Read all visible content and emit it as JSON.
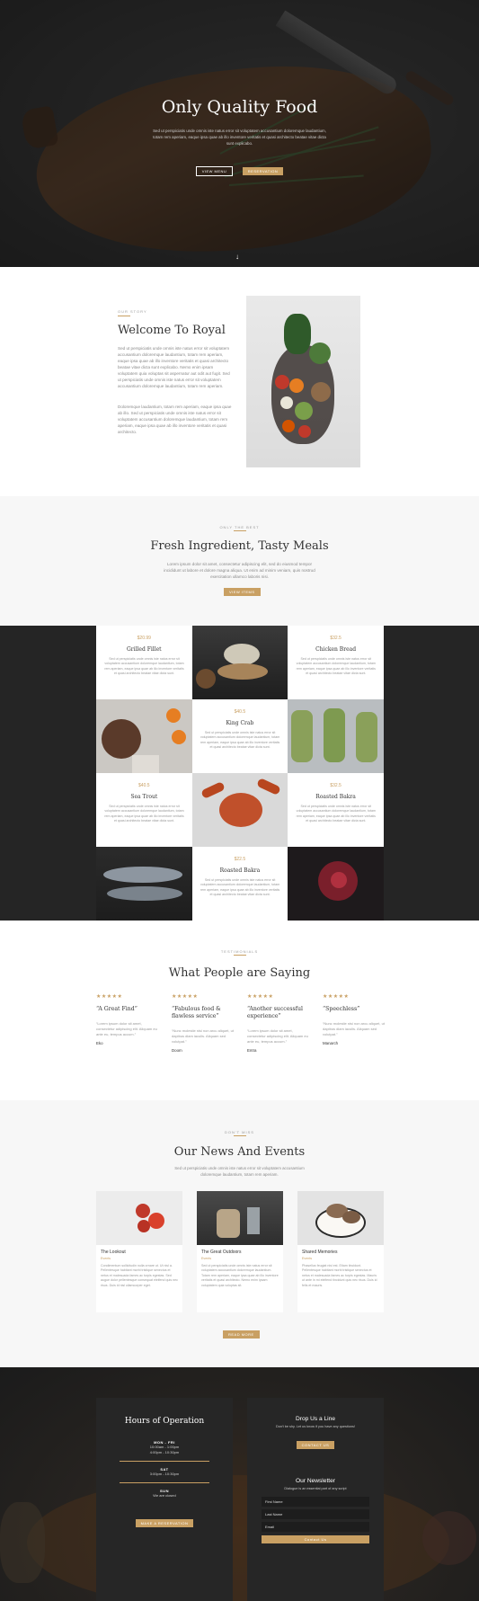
{
  "hero": {
    "title": "Only Quality Food",
    "subtitle": "Sed ut perspiciatis unde omnis iste natus error sit voluptatem accusantium doloremque laudantium, totam rem aperiam, eaque ipsa quae ab illo inventore veritatis et quasi architecto beatae vitae dicta sunt explicabo.",
    "view_menu": "View Menu",
    "reservation": "Reservation",
    "scroll_arrow": "↓"
  },
  "welcome": {
    "kicker": "Our Story",
    "title": "Welcome To Royal",
    "paragraph1": "Sed ut perspiciatis unde omnis iste natus error sit voluptatem accusantium doloremque laudantium, totam rem aperiam, eaque ipsa quae ab illo inventore veritatis et quasi architecto beatae vitae dicta sunt explicabo. Nemo enim ipsam voluptatem quia voluptas sit aspernatur aut odit aut fugit. Sed ut perspiciatis unde omnis iste natus error sit voluptatem accusantium doloremque laudantium, totam rem aperiam.",
    "paragraph2": "Doloremque laudantium, totam rem aperiam, eaque ipsa quae ab illo. Sed ut perspiciatis unde omnis iste natus error sit voluptatem accusantium doloremque laudantium, totam rem aperiam, eaque ipsa quae ab illo inventore veritatis et quasi architecto."
  },
  "fresh": {
    "kicker": "Only The Best",
    "title": "Fresh Ingredient, Tasty Meals",
    "text": "Lorem ipsum dolor sit amet, consectetur adipiscing elit, sed do eiusmod tempor incididunt ut labore et dolore magna aliqua. Ut enim ad minim veniam, quis nostrud exercitation ullamco laboris nisi.",
    "button": "View Items"
  },
  "menu": {
    "items": [
      {
        "price": "$20.99",
        "name": "Grilled Fillet",
        "desc": "Sed ut perspiciatis unde omnis iste natus error sit voluptatem accusantium doloremque laudantium, totam rem aperiam, eaque ipsa quae ab illo inventore veritatis et quasi architecto beatae vitae dicta sunt."
      },
      {
        "price": "$32.5",
        "name": "Chicken Bread",
        "desc": "Sed ut perspiciatis unde omnis iste natus error sit voluptatem accusantium doloremque laudantium, totam rem aperiam, eaque ipsa quae ab illo inventore veritatis et quasi architecto beatae vitae dicta sunt."
      },
      {
        "price": "$40.5",
        "name": "King Crab",
        "desc": "Sed ut perspiciatis unde omnis iste natus error sit voluptatem accusantium doloremque laudantium, totam rem aperiam, eaque ipsa quae ab illo inventore veritatis et quasi architecto beatae vitae dicta sunt."
      },
      {
        "price": "$40.5",
        "name": "Sea Trout",
        "desc": "Sed ut perspiciatis unde omnis iste natus error sit voluptatem accusantium doloremque laudantium, totam rem aperiam, eaque ipsa quae ab illo inventore veritatis et quasi architecto beatae vitae dicta sunt."
      },
      {
        "price": "$32.5",
        "name": "Roasted Bakra",
        "desc": "Sed ut perspiciatis unde omnis iste natus error sit voluptatem accusantium doloremque laudantium, totam rem aperiam, eaque ipsa quae ab illo inventore veritatis et quasi architecto beatae vitae dicta sunt."
      },
      {
        "price": "$22.5",
        "name": "Roasted Bakra",
        "desc": "Sed ut perspiciatis unde omnis iste natus error sit voluptatem accusantium doloremque laudantium, totam rem aperiam, eaque ipsa quae ab illo inventore veritatis et quasi architecto beatae vitae dicta sunt."
      }
    ]
  },
  "testimonials": {
    "kicker": "Testimonials",
    "title": "What People are Saying",
    "items": [
      {
        "stars": "★★★★★",
        "quote": "“A Great Find”",
        "text": "“Lorem ipsum dolor sit amet, consectetur adipiscing elit. Aliquam eu ante eu, tempus accum.”",
        "author": "Eko"
      },
      {
        "stars": "★★★★★",
        "quote": "“Fabulous food & flawless service”",
        "text": "“Nunc molestie nisi non arcu aliquet, ut dapibus diam iaculis. Aliquam sed volutpat.”",
        "author": "Doom"
      },
      {
        "stars": "★★★★★",
        "quote": "“Another successful experience”",
        "text": "“Lorem ipsum dolor sit amet, consectetur adipiscing elit. Aliquam eu ante eu, tempus accum.”",
        "author": "Entra"
      },
      {
        "stars": "★★★★★",
        "quote": "“Speechless”",
        "text": "“Nunc molestie nisi non arcu aliquet, ut dapibus diam iaculis. Aliquam sed volutpat.”",
        "author": "Manarch"
      }
    ]
  },
  "news": {
    "kicker": "Don't Miss",
    "title": "Our News And Events",
    "intro": "Sed ut perspiciatis unde omnis iste natus error sit voluptatem accusantium doloremque laudantium, totam rem aperiam.",
    "button": "Read More",
    "items": [
      {
        "title": "The Lookout",
        "meta": "Events",
        "body": "Condimentum sollicitudin nulla ornare ut. Ut nisl a. Pellentesque habitant morbi tristique senectus et netus et malesuada fames ac turpis egestas. Sed augue dolor pellentesque consequat eleifend quis nec risus. Duis id nisl ullamcorper eget."
      },
      {
        "title": "The Great Outdoors",
        "meta": "Events",
        "body": "Sed ut perspiciatis unde omnis iste natus error sit voluptatem accusantium doloremque laudantium. Totam rem aperiam, eaque ipsa quae ab illo inventore veritatis et quasi architecto. Nemo enim ipsam voluptatem quia voluptas sit."
      },
      {
        "title": "Shared Memories",
        "meta": "Events",
        "body": "Phasellus feugiat nisi est. Etiam tincidunt. Pellentesque habitant morbi tristique senectus et netus et malesuada fames ac turpis egestas. Mauris ut ante in mi eleifend tincidunt quis nec risus. Duis id felis et mauris."
      }
    ]
  },
  "footer": {
    "hours_title": "Hours of Operation",
    "groups": [
      {
        "day": "MON - FRI",
        "times": [
          "10:00am - 1:00pm",
          "4:00pm - 10:30pm"
        ]
      },
      {
        "day": "SAT",
        "times": [
          "3:00pm - 10:30pm"
        ]
      },
      {
        "day": "SUN",
        "times": [
          "We are closed"
        ]
      }
    ],
    "reservation_button": "Make A Reservation",
    "drop_title": "Drop Us a Line",
    "drop_text": "Don't be shy. Let us know if you have any questions!",
    "contact_button": "Contact Us",
    "newsletter_title": "Our Newsletter",
    "newsletter_text": "Dialogue is an essential part of any script",
    "first_name_placeholder": "First Name",
    "last_name_placeholder": "Last Name",
    "email_placeholder": "Email",
    "newsletter_button": "Contact Us"
  },
  "colors": {
    "accent": "#c9a063",
    "dark": "#252525",
    "light_bg": "#f7f7f7"
  }
}
